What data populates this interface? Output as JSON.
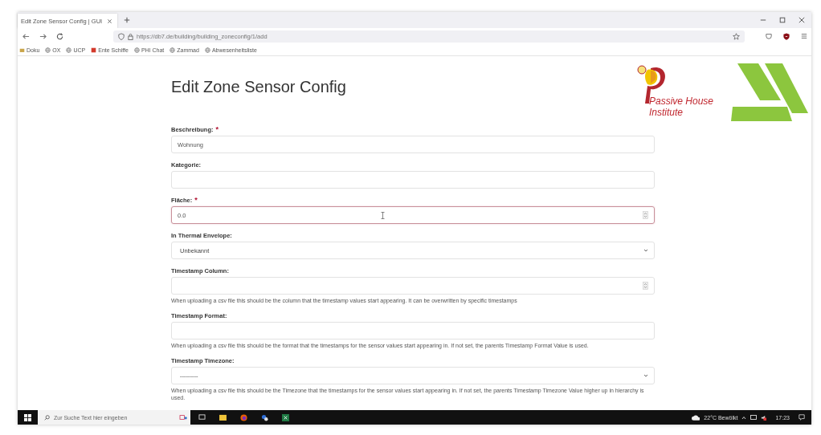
{
  "browser": {
    "tab": {
      "title": "Edit Zone Sensor Config | GUI",
      "selected": true
    },
    "url": "https://db7.de/building/building_zoneconfig/1/add",
    "bookmarks": [
      {
        "label": "Doku",
        "kind": "folder"
      },
      {
        "label": "OX",
        "kind": "globe"
      },
      {
        "label": "UCP",
        "kind": "globe"
      },
      {
        "label": "Ente Schiffe",
        "kind": "image"
      },
      {
        "label": "PHI Chat",
        "kind": "globe"
      },
      {
        "label": "Zammad",
        "kind": "globe"
      },
      {
        "label": "Abwesenheitsliste",
        "kind": "globe"
      }
    ]
  },
  "page": {
    "title": "Edit Zone Sensor Config",
    "logo": {
      "line_1": "Passive House",
      "line_2": "Institute"
    },
    "fields": [
      {
        "label": "Beschreibung:",
        "marker": "*",
        "kind": "text",
        "value": "Wohnung",
        "focused": false
      },
      {
        "label": "Kategorie:",
        "kind": "text",
        "focused": false
      },
      {
        "label": "Fläche:",
        "marker": "*",
        "kind": "number",
        "value": "0.0",
        "focused": true
      },
      {
        "label": "In Thermal Envelope:",
        "kind": "select",
        "value": "Unbekannt",
        "focused": false
      },
      {
        "label": "Timestamp Column:",
        "kind": "number",
        "focused": false,
        "help": "When uploading a csv file this should be the column that the timestamp values start appearing. It can be overwritten by specific timestamps"
      },
      {
        "label": "Timestamp Format:",
        "kind": "text",
        "focused": false,
        "help": "When uploading a csv file this should be the format that the timestamps for the sensor values start appearing in. If not set, the parents Timestamp Format Value is used."
      },
      {
        "label": "Timestamp Timezone:",
        "kind": "select",
        "value": "---------",
        "focused": false,
        "help": "When uploading a csv file this should be the Timezone that the timestamps for the sensor values start appearing in. If not set, the parents Timestamp Timezone Value higher up in hierarchy is used."
      }
    ]
  },
  "taskbar": {
    "search_placeholder": "Zur Suche Text hier eingeben",
    "weather": "22°C Bewölkt",
    "time": "17:23"
  }
}
